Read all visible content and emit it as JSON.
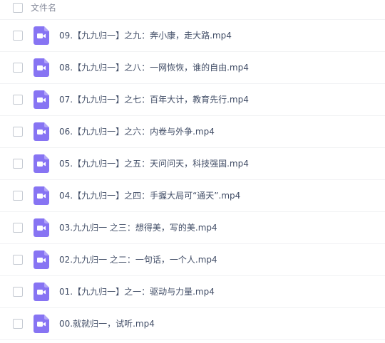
{
  "header": {
    "column_label": "文件名"
  },
  "icon": {
    "name": "video-file-icon",
    "color": "#8774f3"
  },
  "files": [
    {
      "name": "09.【九九归一】之九：奔小康，走大路.mp4"
    },
    {
      "name": "08.【九九归一】之八：一网恢恢，谁的自由.mp4"
    },
    {
      "name": "07.【九九归一】之七：百年大计，教育先行.mp4"
    },
    {
      "name": "06.【九九归一】之六：内卷与外争.mp4"
    },
    {
      "name": "05.【九九归一】之五：天问问天，科技强国.mp4"
    },
    {
      "name": "04.【九九归一】之四：手握大局可“通天”.mp4"
    },
    {
      "name": "03.九九归一 之三：想得美，写的美.mp4"
    },
    {
      "name": "02.九九归一 之二：一句话，一个人.mp4"
    },
    {
      "name": "01.【九九归一】之一：驱动与力量.mp4"
    },
    {
      "name": "00.就就归一，试听.mp4"
    }
  ]
}
